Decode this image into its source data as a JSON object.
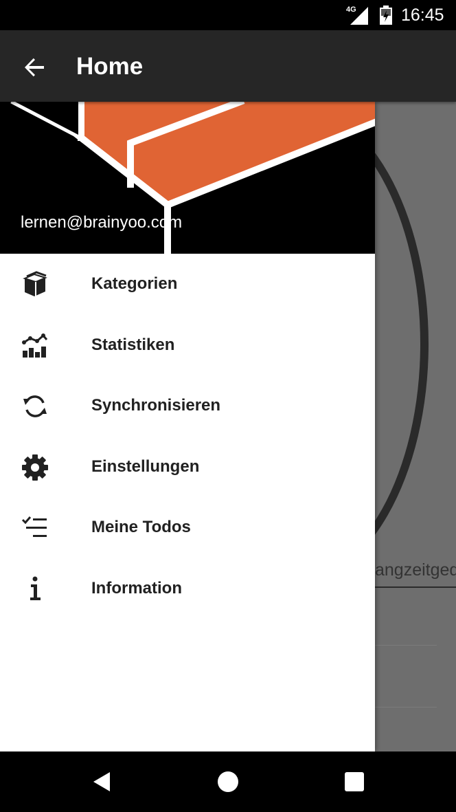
{
  "status_bar": {
    "network": "4G",
    "time": "16:45"
  },
  "app_bar": {
    "title": "Home",
    "back_icon": "arrow-back-icon"
  },
  "drawer": {
    "email": "lernen@brainyoo.com",
    "header_colors": {
      "accent": "#e06434",
      "lines": "#ffffff",
      "background": "#000000"
    },
    "items": [
      {
        "label": "Kategorien",
        "icon": "box-stack-icon"
      },
      {
        "label": "Statistiken",
        "icon": "statistics-chart-icon"
      },
      {
        "label": "Synchronisieren",
        "icon": "sync-icon"
      },
      {
        "label": "Einstellungen",
        "icon": "gear-icon"
      },
      {
        "label": "Meine Todos",
        "icon": "checklist-icon"
      },
      {
        "label": "Information",
        "icon": "info-icon"
      }
    ]
  },
  "background": {
    "partial_text": "angzeitged"
  },
  "nav_bar": {
    "back": "nav-back-icon",
    "home": "nav-home-icon",
    "recents": "nav-recents-icon"
  }
}
